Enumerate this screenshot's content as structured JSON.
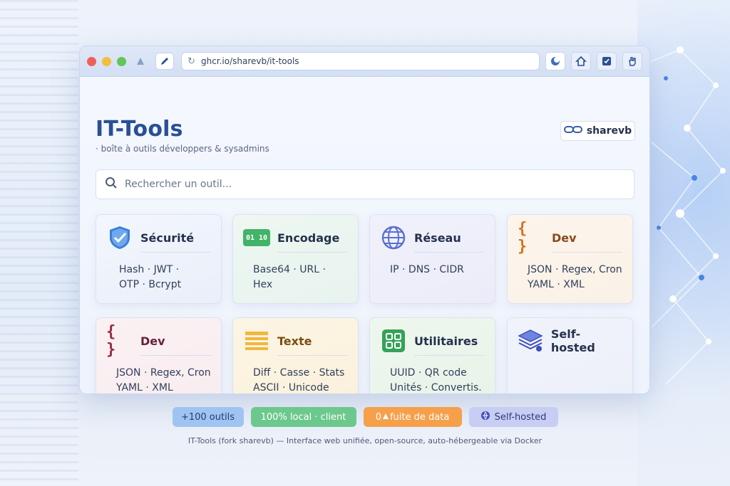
{
  "browser": {
    "url": "ghcr.io/sharevb/it-tools"
  },
  "header": {
    "title": "IT-Tools",
    "subtitle": "· boîte à outils développers & sysadmins",
    "brand": "sharevb"
  },
  "search": {
    "placeholder": "Rechercher un outil..."
  },
  "cards": [
    {
      "title": "Sécurité",
      "line1": "Hash · JWT ·",
      "line2": "OTP · Bcrypt"
    },
    {
      "title": "Encodage",
      "badge": "01 10",
      "line1": "Base64 · URL · Hex",
      "line2": ""
    },
    {
      "title": "Réseau",
      "line1": "IP · DNS · CIDR",
      "line2": ""
    },
    {
      "title": "Dev",
      "icon": "{ }",
      "line1": "JSON · Regex, Cron",
      "line2": "YAML · XML"
    },
    {
      "title": "Dev",
      "icon": "{ }",
      "line1": "JSON · Regex, Cron",
      "line2": "YAML · XML"
    },
    {
      "title": "Texte",
      "line1": "Diff · Casse · Stats",
      "line2": "ASCII · Unicode"
    },
    {
      "title": "Utilitaires",
      "line1": "UUID · QR code",
      "line2": "Unités · Convertis."
    },
    {
      "title": "Self-hosted",
      "line1": "",
      "line2": ""
    }
  ],
  "pills": [
    {
      "label": "+100 outils",
      "color": "#9fc4f1"
    },
    {
      "label": "100% local · client",
      "color": "#6cc88c"
    },
    {
      "label": "fuite de data",
      "prefix": "0",
      "color": "#f6a04c"
    },
    {
      "label": "Self-hosted",
      "color": "#c7cdf3"
    }
  ],
  "footer": {
    "text": "IT-Tools (fork sharevb) — Interface web unifiée, open-source, auto-hébergeable via Docker"
  },
  "colors": {
    "accent": "#2a4f95",
    "shield": "#3b7fd9",
    "encodage": "#43b36a",
    "reseau": "#5a6fd0",
    "dev_orange": "#d2731a",
    "dev_red": "#9a2a44",
    "texte": "#f2b63a",
    "utilitaires": "#35a257"
  }
}
